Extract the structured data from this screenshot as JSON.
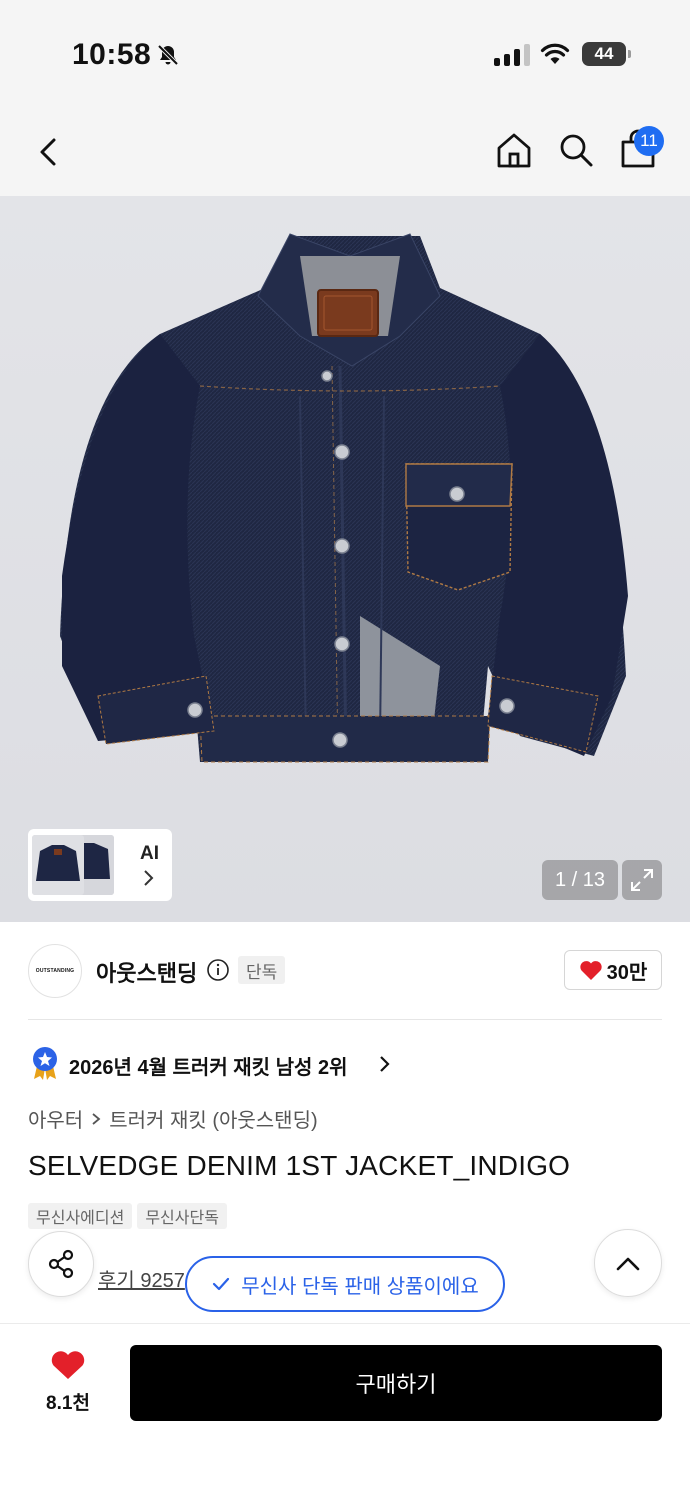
{
  "status_bar": {
    "time": "10:58",
    "battery": "44"
  },
  "header": {
    "cart_count": "11",
    "accent": "#1f6df2"
  },
  "gallery": {
    "ai_label": "AI",
    "counter": "1 / 13"
  },
  "brand": {
    "logo_text": "OUTSTANDING",
    "name": "아웃스탠딩",
    "tag": "단독",
    "likes": "30만"
  },
  "ranking": {
    "text": "2026년 4월 트러커 재킷 남성 2위"
  },
  "breadcrumb": {
    "category": "아우터",
    "subcategory": "트러커 재킷 (아웃스탠딩)"
  },
  "product": {
    "title": "SELVEDGE DENIM 1ST JACKET_INDIGO",
    "tags": [
      "무신사에디션",
      "무신사단독"
    ],
    "review_text": "후기 9257"
  },
  "toast": {
    "text": "무신사 단독 판매 상품이에요"
  },
  "bottom": {
    "wish_count": "8.1천",
    "buy_label": "구매하기"
  },
  "colors": {
    "heart": "#e3202a",
    "toast": "#2a62e8",
    "buy_button": "#000000"
  }
}
